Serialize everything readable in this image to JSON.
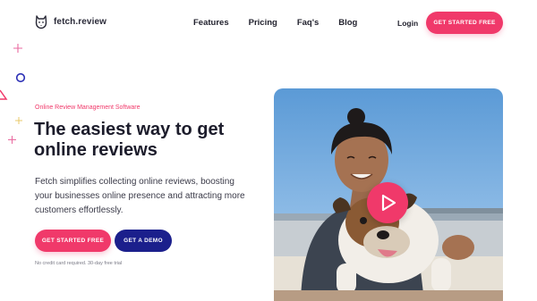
{
  "brand": {
    "name": "fetch.review",
    "icon": "dog-logo-icon"
  },
  "nav": {
    "links": [
      "Features",
      "Pricing",
      "Faq's",
      "Blog"
    ],
    "login": "Login",
    "cta": "GET STARTED FREE"
  },
  "hero": {
    "kicker": "Online Review Management Software",
    "headline": "The easiest way to get online reviews",
    "description": "Fetch simplifies collecting online reviews, boosting your businesses online presence and attracting more customers effortlessly.",
    "primary_button": "GET STARTED FREE",
    "secondary_button": "GET A DEMO",
    "note": "No credit card required. 30-day free trial",
    "media": {
      "image": "woman-with-bulldog-photo",
      "overlay_icon": "play-icon"
    }
  },
  "colors": {
    "accent": "#f0396a",
    "secondary": "#1b1f8c",
    "text": "#1c1c2b"
  }
}
